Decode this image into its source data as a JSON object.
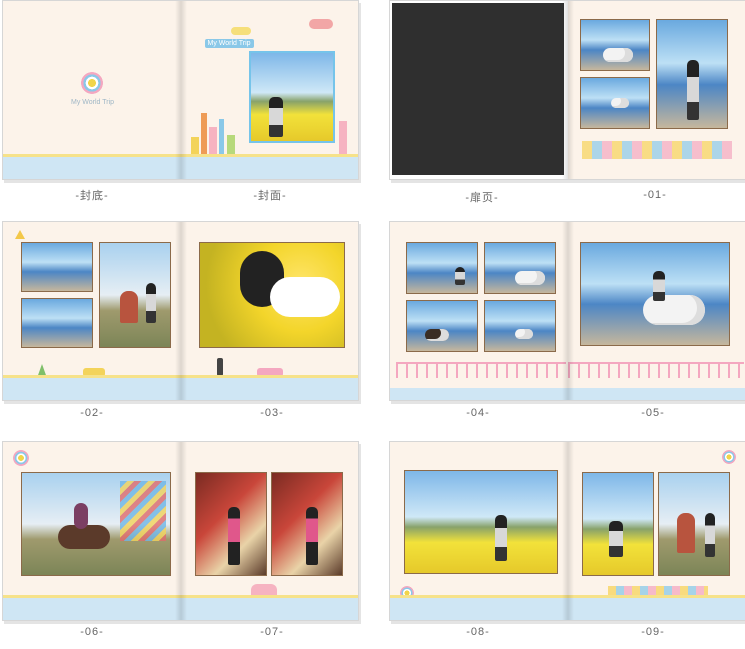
{
  "brand": {
    "title": "My World Trip",
    "cover_tag": "My World Trip"
  },
  "captions": [
    "-封底-",
    "-封面-",
    "-扉页-",
    "-01-",
    "-02-",
    "-03-",
    "-04-",
    "-05-",
    "-06-",
    "-07-",
    "-08-",
    "-09-"
  ],
  "colors": {
    "page_bg": "#fcf3ea",
    "band_blue": "#cfe6f4",
    "band_yellow": "#f6e28a",
    "photo_border": "#8b6a4a",
    "caption_text": "#666666"
  },
  "icons": [
    "flower-logo-icon",
    "cloud-icon",
    "traffic-light-icon",
    "bus-icon",
    "tree-icon",
    "warning-sign-icon",
    "windmill-icon"
  ]
}
